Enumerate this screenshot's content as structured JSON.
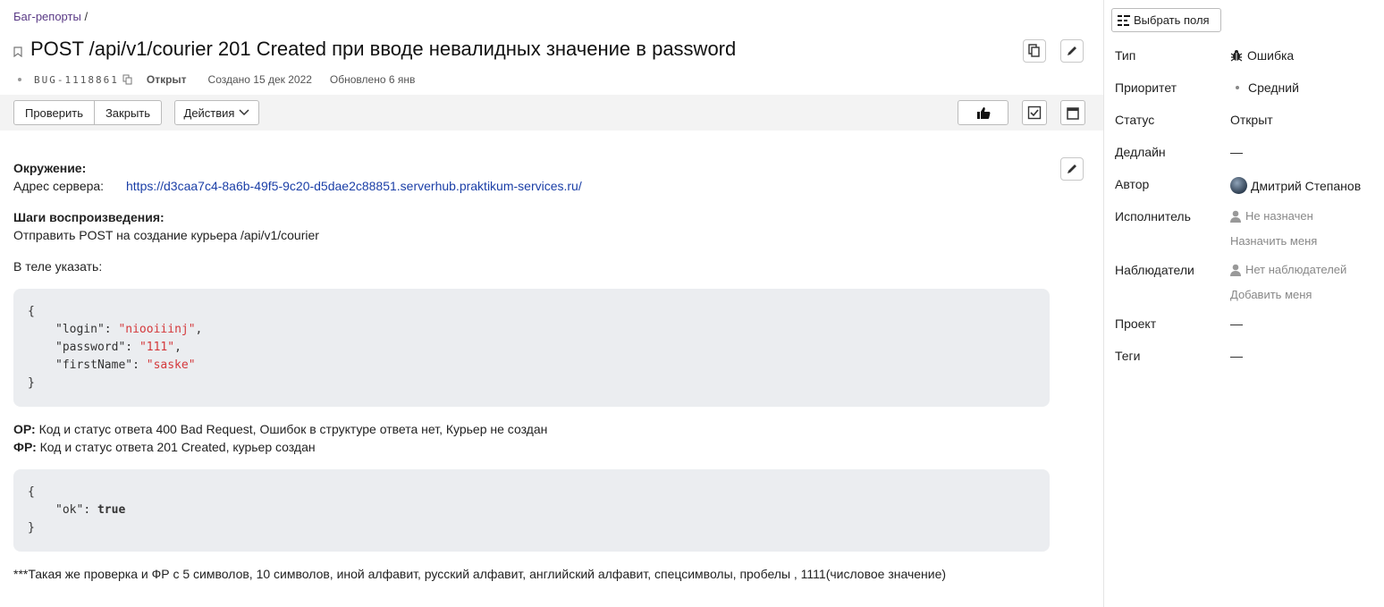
{
  "breadcrumb": {
    "link": "Баг-репорты",
    "separator": "/"
  },
  "issue": {
    "title": "POST /api/v1/courier 201 Created при вводе невалидных значение в password",
    "key": "BUG-1118861",
    "status": "Открыт",
    "created": "Создано 15 дек 2022",
    "updated": "Обновлено 6 янв"
  },
  "toolbar": {
    "check": "Проверить",
    "close": "Закрыть",
    "actions": "Действия"
  },
  "body": {
    "env_label": "Окружение:",
    "server_label": "Адрес сервера:",
    "server_url": "https://d3caa7c4-8a6b-49f5-9c20-d5dae2c88851.serverhub.praktikum-services.ru/",
    "steps_label": "Шаги воспроизведения:",
    "step1": "Отправить POST на создание курьера /api/v1/courier",
    "step2": "В теле указать:",
    "code1": {
      "open": "{",
      "login_key": "\"login\"",
      "login_val": "\"niooiiinj\"",
      "password_key": "\"password\"",
      "password_val": "\"111\"",
      "firstname_key": "\"firstName\"",
      "firstname_val": "\"saske\"",
      "close": "}"
    },
    "op_label": "ОР:",
    "op_text": "Код и статус ответа 400 Bad Request, Ошибок в структуре ответа нет, Курьер не создан",
    "fr_label": "ФР:",
    "fr_text": "Код и статус ответа 201 Created, курьер создан",
    "code2": {
      "open": "{",
      "ok_key": "\"ok\"",
      "ok_val": "true",
      "close": "}"
    },
    "note": "***Такая же проверка и ФР с 5 символов, 10 символов, иной алфавит, русский алфавит, английский алфавит, спецсимволы, пробелы , 1111(числовое значение)"
  },
  "sidebar": {
    "select_fields": "Выбрать поля",
    "fields": [
      {
        "label": "Тип",
        "value": "Ошибка"
      },
      {
        "label": "Приоритет",
        "value": "Средний"
      },
      {
        "label": "Статус",
        "value": "Открыт"
      },
      {
        "label": "Дедлайн",
        "value": "—"
      },
      {
        "label": "Автор",
        "value": "Дмитрий Степанов"
      },
      {
        "label": "Исполнитель",
        "value": "Не назначен",
        "action": "Назначить меня"
      },
      {
        "label": "Наблюдатели",
        "value": "Нет наблюдателей",
        "action": "Добавить меня"
      },
      {
        "label": "Проект",
        "value": "—"
      },
      {
        "label": "Теги",
        "value": "—"
      }
    ]
  },
  "colors": {
    "link": "#1b3fa7",
    "code_bg": "#ebedf0",
    "string": "#d4383b"
  },
  "icons": [
    "bookmark-icon",
    "copy-icon",
    "pencil-icon",
    "thumbs-up-icon",
    "checkbox-icon",
    "calendar-icon",
    "bug-icon",
    "user-icon",
    "fields-icon"
  ]
}
